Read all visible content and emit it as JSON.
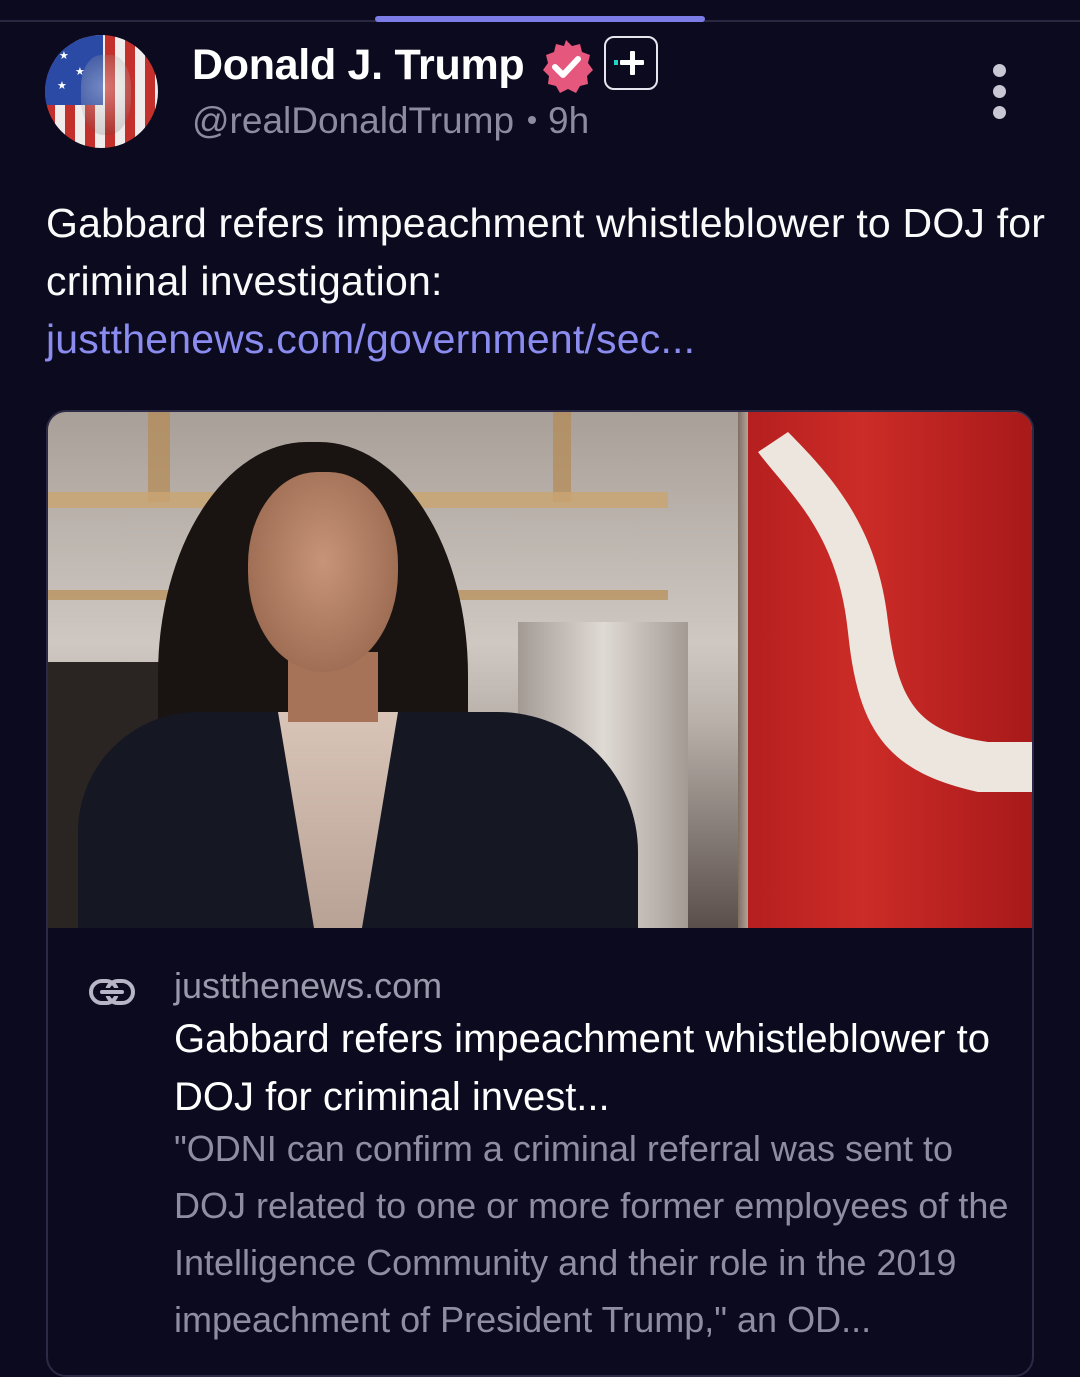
{
  "post": {
    "author_name": "Donald J. Trump",
    "handle": "@realDonaldTrump",
    "time": "9h",
    "text": "Gabbard refers impeachment whistleblower to DOJ for criminal investigation: ",
    "link_text": "justthenews.com/government/sec..."
  },
  "card": {
    "domain": "justthenews.com",
    "title": "Gabbard refers impeachment whistleblower to DOJ for criminal invest...",
    "description": "\"ODNI can confirm a criminal referral was sent to DOJ related to one or more former employees of the Intelligence Community and their role in the 2019 impeachment of President Trump,\" an OD..."
  },
  "icons": {
    "verified": "verified-badge-icon",
    "plus": "plus-icon",
    "more": "more-vertical-icon",
    "link": "link-icon"
  },
  "colors": {
    "background": "#0c0a1f",
    "link": "#8a8cf0",
    "verified_badge": "#e5577c",
    "secondary_text": "#8d8b9f",
    "indicator": "#7b7ce6"
  }
}
